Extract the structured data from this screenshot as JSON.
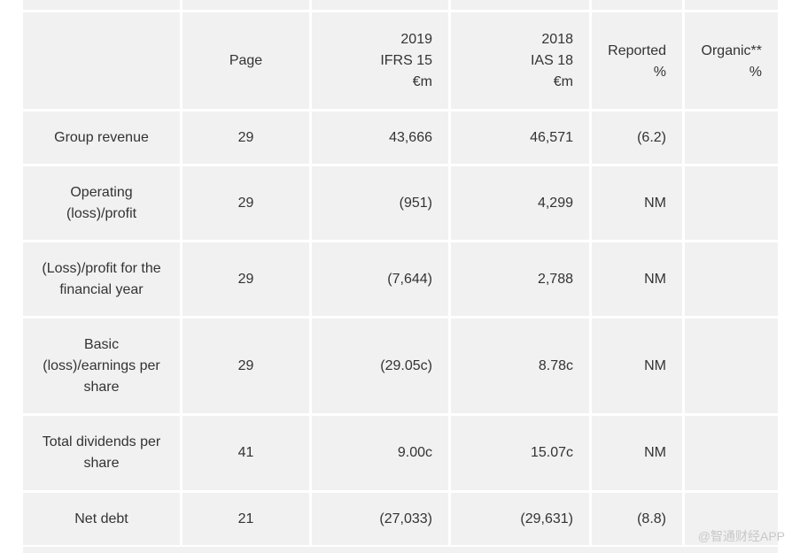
{
  "table": {
    "header": {
      "col1": "",
      "col2": "Page",
      "col3": "2019\nIFRS 15\n€m",
      "col4": "2018\nIAS 18\n€m",
      "col5": "Reported\n%",
      "col6": "Organic**\n%"
    },
    "rows": [
      {
        "label": "Group revenue",
        "page": "29",
        "y2019": "43,666",
        "y2018": "46,571",
        "reported": "(6.2)",
        "organic": ""
      },
      {
        "label": "Operating\n(loss)/profit",
        "page": "29",
        "y2019": "(951)",
        "y2018": "4,299",
        "reported": "NM",
        "organic": ""
      },
      {
        "label": "(Loss)/profit for the\nfinancial year",
        "page": "29",
        "y2019": "(7,644)",
        "y2018": "2,788",
        "reported": "NM",
        "organic": ""
      },
      {
        "label": "Basic\n(loss)/earnings per\nshare",
        "page": "29",
        "y2019": "(29.05c)",
        "y2018": "8.78c",
        "reported": "NM",
        "organic": ""
      },
      {
        "label": "Total dividends per\nshare",
        "page": "41",
        "y2019": "9.00c",
        "y2018": "15.07c",
        "reported": "NM",
        "organic": ""
      },
      {
        "label": "Net debt",
        "page": "21",
        "y2019": "(27,033)",
        "y2018": "(29,631)",
        "reported": "(8.8)",
        "organic": ""
      }
    ]
  },
  "watermark": "@智通财经APP"
}
